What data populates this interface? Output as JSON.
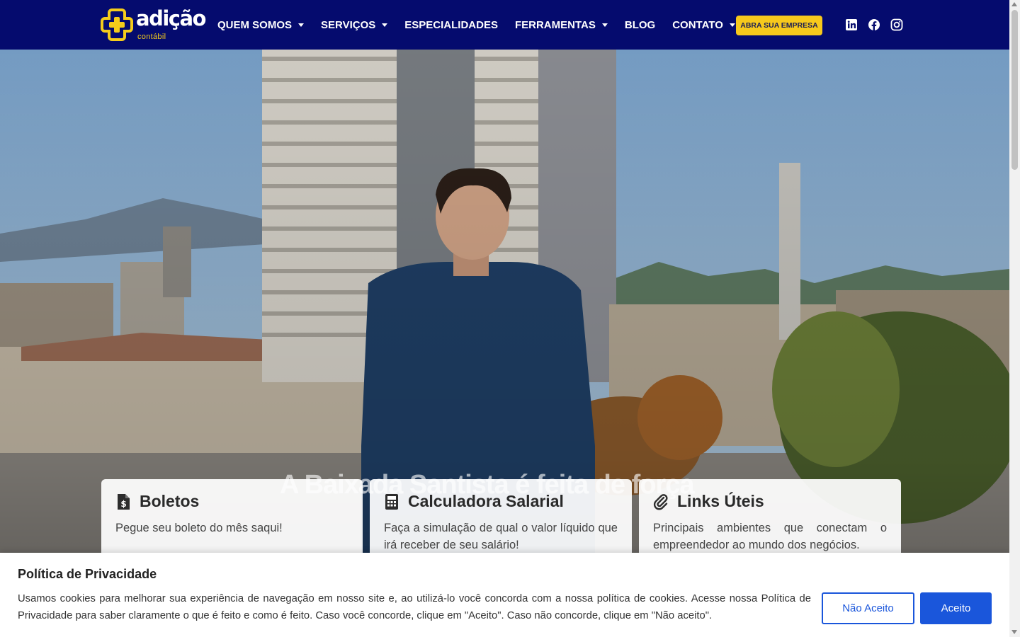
{
  "header": {
    "logo": {
      "word": "adição",
      "sub": "contábil"
    },
    "nav": [
      {
        "label": "QUEM SOMOS",
        "has_dropdown": true
      },
      {
        "label": "SERVIÇOS",
        "has_dropdown": true
      },
      {
        "label": "ESPECIALIDADES",
        "has_dropdown": false
      },
      {
        "label": "FERRAMENTAS",
        "has_dropdown": true
      },
      {
        "label": "BLOG",
        "has_dropdown": false
      },
      {
        "label": "CONTATO",
        "has_dropdown": true
      }
    ],
    "cta_label": "ABRA SUA EMPRESA",
    "social_icons": [
      "linkedin-icon",
      "facebook-icon",
      "instagram-icon"
    ]
  },
  "hero": {
    "caption": "A Baixada Santista é feita de força"
  },
  "cards": [
    {
      "icon": "invoice-dollar-icon",
      "title": "Boletos",
      "text": "Pegue seu boleto do mês saqui!"
    },
    {
      "icon": "calculator-icon",
      "title": "Calculadora Salarial",
      "text": "Faça a simulação de qual o valor líquido que irá receber de seu salário!"
    },
    {
      "icon": "paperclip-icon",
      "title": "Links Úteis",
      "text": "Principais ambientes que conectam o empreendedor ao mundo dos negócios."
    }
  ],
  "cookie": {
    "title": "Política de Privacidade",
    "text_before": "Usamos cookies para melhorar sua experiência de navegação em nosso site e, ao utilizá-lo você concorda com a nossa política de cookies. Acesse nossa ",
    "link_label": "Política de Privacidade",
    "text_after": " para saber claramente o que é feito e como é feito. Caso você concorde, clique em \"Aceito\". Caso não concorde, clique em \"Não aceito\".",
    "reject_label": "Não Aceito",
    "accept_label": "Aceito"
  },
  "colors": {
    "header_bg": "#050b6e",
    "brand_yellow": "#f7c91c",
    "button_blue": "#1a56db"
  }
}
